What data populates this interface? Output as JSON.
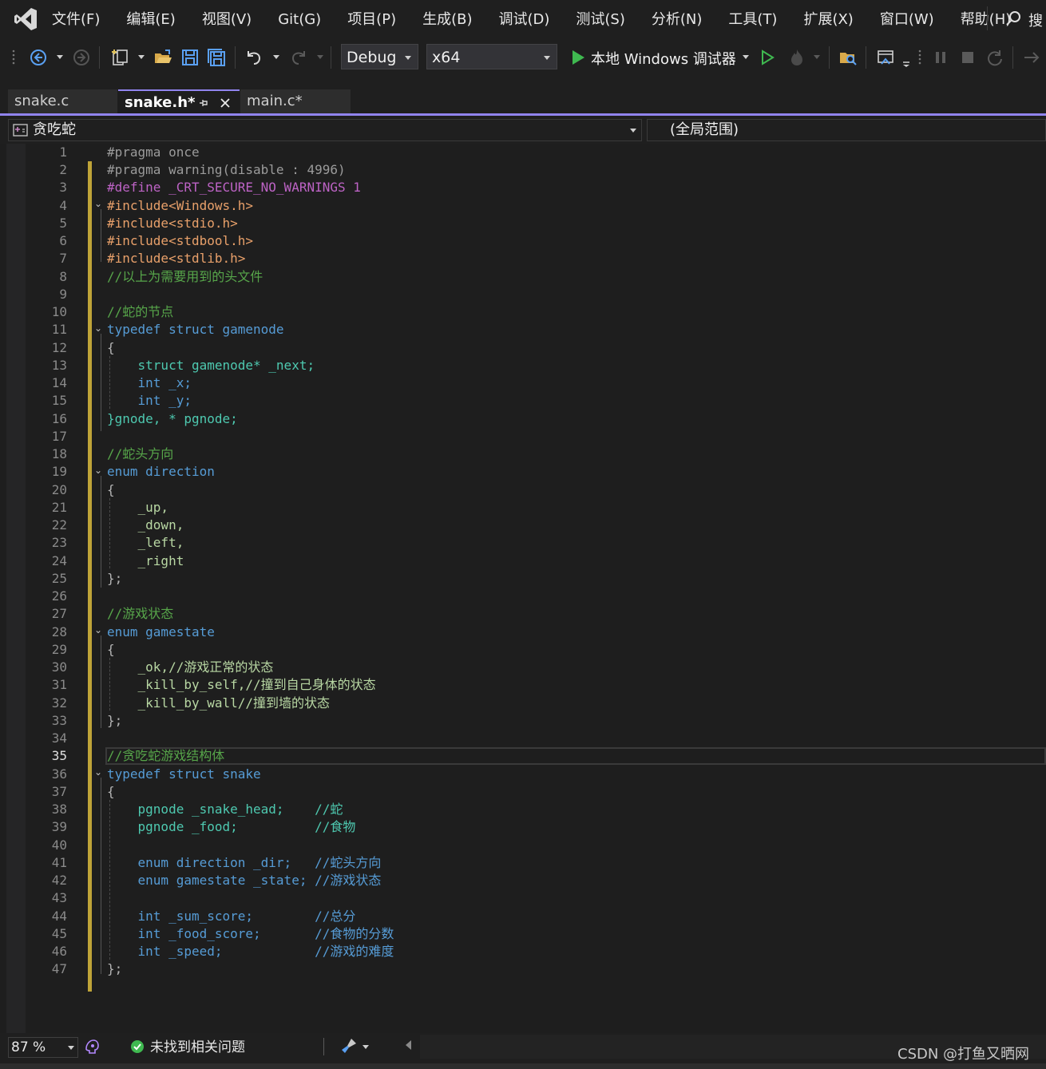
{
  "menu": {
    "items": [
      "文件(F)",
      "编辑(E)",
      "视图(V)",
      "Git(G)",
      "项目(P)",
      "生成(B)",
      "调试(D)",
      "测试(S)",
      "分析(N)",
      "工具(T)",
      "扩展(X)",
      "窗口(W)",
      "帮助(H)"
    ],
    "search_label": "搜"
  },
  "toolbar": {
    "configuration": "Debug",
    "platform": "x64",
    "debugger_label": "本地 Windows 调试器"
  },
  "tabs": [
    {
      "label": "snake.c",
      "active": false
    },
    {
      "label": "snake.h*",
      "active": true
    },
    {
      "label": "main.c*",
      "active": false
    }
  ],
  "navbar": {
    "scope_left": "贪吃蛇",
    "scope_right": "(全局范围)"
  },
  "editor": {
    "current_line": 35,
    "lines": [
      "#pragma once",
      "#pragma warning(disable : 4996)",
      "#define _CRT_SECURE_NO_WARNINGS 1",
      "#include<Windows.h>",
      "#include<stdio.h>",
      "#include<stdbool.h>",
      "#include<stdlib.h>",
      "//以上为需要用到的头文件",
      "",
      "//蛇的节点",
      "typedef struct gamenode",
      "{",
      "    struct gamenode* _next;",
      "    int _x;",
      "    int _y;",
      "}gnode, * pgnode;",
      "",
      "//蛇头方向",
      "enum direction",
      "{",
      "    _up,",
      "    _down,",
      "    _left,",
      "    _right",
      "};",
      "",
      "//游戏状态",
      "enum gamestate",
      "{",
      "    _ok,//游戏正常的状态",
      "    _kill_by_self,//撞到自己身体的状态",
      "    _kill_by_wall//撞到墙的状态",
      "};",
      "",
      "//贪吃蛇游戏结构体",
      "typedef struct snake",
      "{",
      "    pgnode _snake_head;    //蛇",
      "    pgnode _food;          //食物",
      "",
      "    enum direction _dir;   //蛇头方向",
      "    enum gamestate _state; //游戏状态",
      "",
      "    int _sum_score;        //总分",
      "    int _food_score;       //食物的分数",
      "    int _speed;            //游戏的难度",
      "};"
    ]
  },
  "status": {
    "zoom": "87 %",
    "issues": "未找到相关问题"
  },
  "watermark": "CSDN @打鱼又晒网",
  "colors": {
    "accent": "#9184ee",
    "keyword": "#569cd6",
    "type": "#4ec9b0",
    "comment": "#57a64a",
    "string": "#e8a06a",
    "macro": "#bd63c5",
    "run_green": "#3fb950",
    "change_bar": "#bfa438"
  }
}
